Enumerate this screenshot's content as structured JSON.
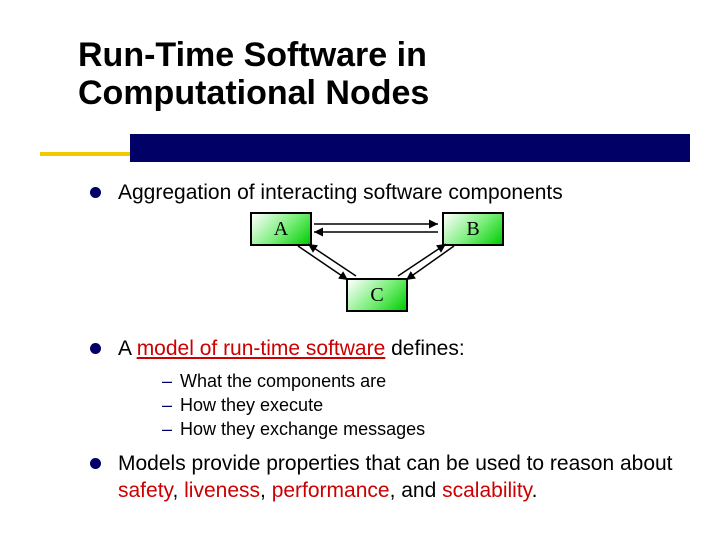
{
  "title_line1": "Run-Time Software in",
  "title_line2": "Computational Nodes",
  "bullets": {
    "b1": "Aggregation of interacting software components",
    "b2_prefix": "A ",
    "b2_term": "model of run-time software",
    "b2_suffix": " defines:",
    "sub": {
      "s1": "What the components are",
      "s2": "How they execute",
      "s3": "How they exchange messages"
    },
    "b3_prefix": "Models provide properties that can be used to reason about ",
    "b3_w1": "safety",
    "b3_sep1": ", ",
    "b3_w2": "liveness",
    "b3_sep2": ", ",
    "b3_w3": "performance",
    "b3_sep3": ", and ",
    "b3_w4": "scalability",
    "b3_end": "."
  },
  "diagram": {
    "A": "A",
    "B": "B",
    "C": "C"
  },
  "colors": {
    "accent": "#000066",
    "danger": "#cc0000",
    "gold": "#f2c800",
    "box_grad_end": "#00cc00"
  }
}
